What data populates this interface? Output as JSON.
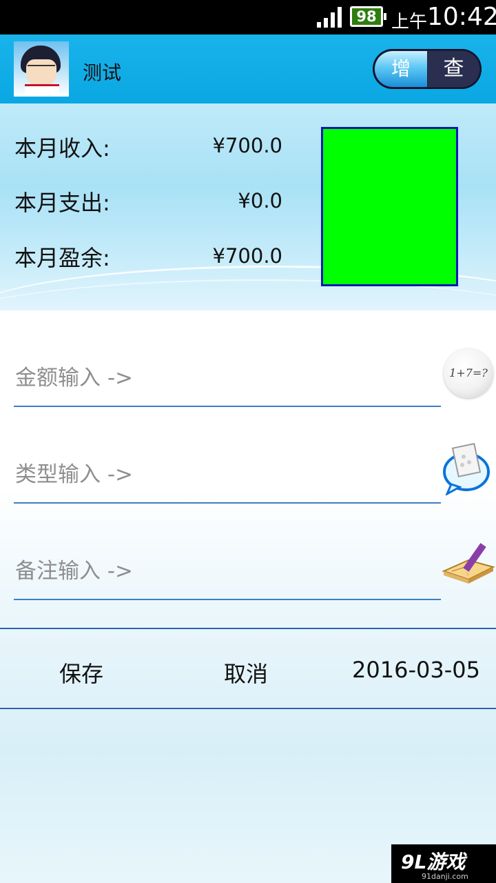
{
  "status_bar": {
    "battery": "98",
    "time_prefix": "上午",
    "time": "10:42"
  },
  "app_bar": {
    "title": "测试",
    "toggle_add": "增",
    "toggle_query": "查"
  },
  "summary": {
    "rows": [
      {
        "label": "本月收入:",
        "value": "¥700.0"
      },
      {
        "label": "本月支出:",
        "value": "¥0.0"
      },
      {
        "label": "本月盈余:",
        "value": "¥700.0"
      }
    ],
    "chart_color": "#00ff00"
  },
  "form": {
    "amount_placeholder": "金额输入 ->",
    "type_placeholder": "类型输入 ->",
    "note_placeholder": "备注输入 ->"
  },
  "actions": {
    "save": "保存",
    "cancel": "取消",
    "date": "2016-03-05"
  },
  "watermark": {
    "logo": "9L游戏",
    "site": "91danji.com"
  },
  "colors": {
    "app_bar": "#0aa7e3",
    "accent_line": "#3e7dc2"
  }
}
